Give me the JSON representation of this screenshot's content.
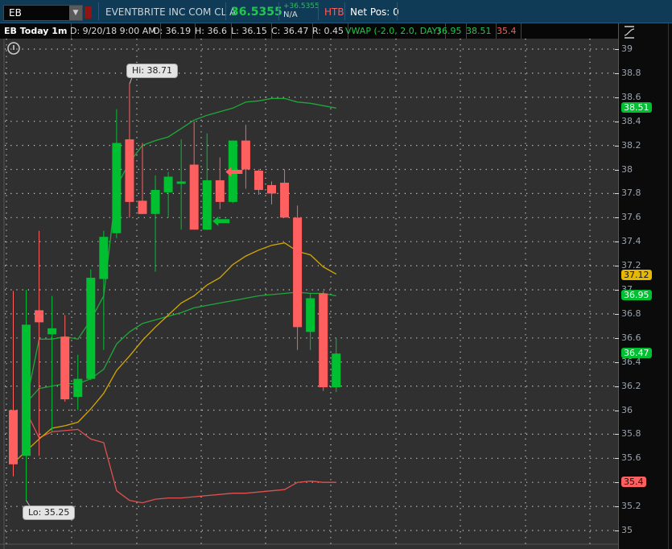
{
  "topbar": {
    "symbol": "EB",
    "company": "EVENTBRITE INC COM CL A",
    "last": "36.5355",
    "change": "+36.5355",
    "change_pct": "N/A",
    "htb": "HTB",
    "net_pos": "Net Pos: 0"
  },
  "header": {
    "title": "EB Today 1m",
    "date": "D: 9/20/18 9:00 AM",
    "open": "O: 36.19",
    "high": "H: 36.6",
    "low": "L: 36.15",
    "close": "C: 36.47",
    "range": "R: 0.45",
    "study": "VWAP (-2.0, 2.0, DAY)",
    "vwap": "36.95",
    "upper": "38.51",
    "lower": "35.4"
  },
  "colors": {
    "up": "#00c032",
    "down": "#ff5f5f",
    "vwap": "#1fa83a",
    "lower": "#e05050",
    "ma": "#d4a800",
    "bg": "#303030"
  },
  "chart_data": {
    "type": "candlestick",
    "ylim": [
      35,
      39
    ],
    "y_ticks": [
      "39",
      "38.8",
      "38.6",
      "38.4",
      "38.2",
      "38",
      "37.8",
      "37.6",
      "37.4",
      "37.2",
      "37",
      "36.8",
      "36.6",
      "36.4",
      "36.2",
      "36",
      "35.8",
      "35.6",
      "35.4",
      "35.2",
      "35"
    ],
    "grid": true,
    "candles": [
      {
        "o": 36.0,
        "h": 36.99,
        "l": 35.45,
        "c": 35.55
      },
      {
        "o": 35.62,
        "h": 37.0,
        "l": 35.25,
        "c": 36.71
      },
      {
        "o": 36.83,
        "h": 37.49,
        "l": 35.62,
        "c": 36.73
      },
      {
        "o": 36.63,
        "h": 36.95,
        "l": 35.82,
        "c": 36.68
      },
      {
        "o": 36.61,
        "h": 36.79,
        "l": 36.07,
        "c": 36.09
      },
      {
        "o": 36.11,
        "h": 36.46,
        "l": 36.0,
        "c": 36.26
      },
      {
        "o": 36.26,
        "h": 37.17,
        "l": 36.25,
        "c": 37.1
      },
      {
        "o": 37.09,
        "h": 37.49,
        "l": 36.5,
        "c": 37.44
      },
      {
        "o": 37.47,
        "h": 38.5,
        "l": 37.43,
        "c": 38.22
      },
      {
        "o": 38.25,
        "h": 38.71,
        "l": 37.6,
        "c": 37.73
      },
      {
        "o": 37.74,
        "h": 38.22,
        "l": 37.63,
        "c": 37.63
      },
      {
        "o": 37.63,
        "h": 37.95,
        "l": 37.15,
        "c": 37.83
      },
      {
        "o": 37.81,
        "h": 37.98,
        "l": 37.6,
        "c": 37.94
      },
      {
        "o": 37.88,
        "h": 38.25,
        "l": 37.5,
        "c": 37.9
      },
      {
        "o": 38.04,
        "h": 38.4,
        "l": 37.5,
        "c": 37.5
      },
      {
        "o": 37.5,
        "h": 38.3,
        "l": 37.5,
        "c": 37.91
      },
      {
        "o": 37.91,
        "h": 38.1,
        "l": 37.67,
        "c": 37.73
      },
      {
        "o": 37.73,
        "h": 38.24,
        "l": 37.72,
        "c": 38.24
      },
      {
        "o": 38.24,
        "h": 38.37,
        "l": 37.84,
        "c": 38.0
      },
      {
        "o": 37.99,
        "h": 38.0,
        "l": 37.79,
        "c": 37.83
      },
      {
        "o": 37.87,
        "h": 37.9,
        "l": 37.71,
        "c": 37.8
      },
      {
        "o": 37.89,
        "h": 38.0,
        "l": 37.6,
        "c": 37.6
      },
      {
        "o": 37.6,
        "h": 37.7,
        "l": 36.5,
        "c": 36.69
      },
      {
        "o": 36.65,
        "h": 36.97,
        "l": 36.5,
        "c": 36.93
      },
      {
        "o": 36.97,
        "h": 36.99,
        "l": 36.16,
        "c": 36.19
      },
      {
        "o": 36.19,
        "h": 36.6,
        "l": 36.15,
        "c": 36.47
      }
    ],
    "series": [
      {
        "key": "upper",
        "start": 1,
        "values": [
          36.06,
          36.59,
          36.59,
          36.61,
          36.59,
          36.75,
          36.95,
          37.86,
          38.06,
          38.2,
          38.24,
          38.27,
          38.34,
          38.41,
          38.45,
          38.48,
          38.51,
          38.56,
          38.57,
          38.59,
          38.59,
          38.56,
          38.55,
          38.53,
          38.51
        ]
      },
      {
        "key": "vwap",
        "start": 1,
        "values": [
          36.06,
          36.18,
          36.2,
          36.22,
          36.22,
          36.26,
          36.34,
          36.55,
          36.65,
          36.72,
          36.75,
          36.78,
          36.81,
          36.85,
          36.87,
          36.89,
          36.91,
          36.93,
          36.95,
          36.96,
          36.97,
          36.98,
          36.97,
          36.97,
          36.95
        ]
      },
      {
        "key": "lower",
        "start": 1,
        "values": [
          35.99,
          35.77,
          35.82,
          35.83,
          35.84,
          35.76,
          35.73,
          35.33,
          35.25,
          35.23,
          35.26,
          35.27,
          35.27,
          35.28,
          35.29,
          35.3,
          35.31,
          35.31,
          35.32,
          35.33,
          35.34,
          35.4,
          35.41,
          35.4,
          35.4
        ]
      },
      {
        "key": "ma",
        "start": 0,
        "values": [
          35.56,
          35.66,
          35.76,
          35.85,
          35.87,
          35.9,
          36.01,
          36.14,
          36.33,
          36.45,
          36.58,
          36.69,
          36.79,
          36.89,
          36.95,
          37.04,
          37.1,
          37.21,
          37.28,
          37.33,
          37.37,
          37.39,
          37.32,
          37.29,
          37.19,
          37.13
        ]
      }
    ],
    "markers": [
      {
        "candle": 16,
        "price": 37.98,
        "color": "down",
        "direction": "left"
      },
      {
        "candle": 15,
        "price": 37.57,
        "color": "up",
        "direction": "left"
      }
    ],
    "hi_label": "Hi: 38.71",
    "lo_label": "Lo: 35.25",
    "price_labels": [
      {
        "text": "38.51",
        "price": 38.51,
        "color": "#00c032",
        "fg": "#ffffff"
      },
      {
        "text": "37.12",
        "price": 37.12,
        "color": "#e6b800",
        "fg": "#111111"
      },
      {
        "text": "36.95",
        "price": 36.95,
        "color": "#00c032",
        "fg": "#ffffff"
      },
      {
        "text": "36.47",
        "price": 36.47,
        "color": "#00c032",
        "fg": "#ffffff"
      },
      {
        "text": "35.4",
        "price": 35.4,
        "color": "#ff5f5f",
        "fg": "#111111"
      }
    ]
  }
}
